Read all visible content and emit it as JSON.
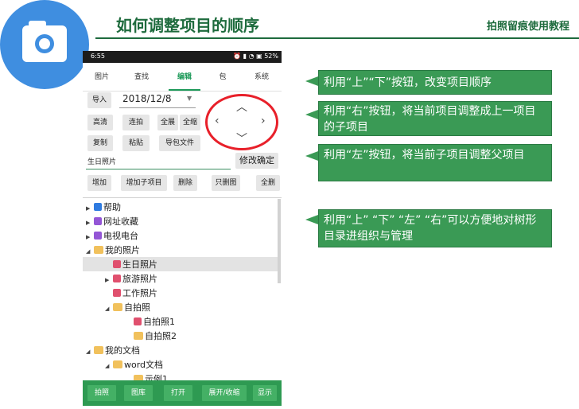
{
  "header": {
    "title": "如何调整项目的顺序",
    "subtitle": "拍照留痕使用教程",
    "logo_icon": "camera-icon"
  },
  "phone": {
    "status_bar": {
      "time": "6:55",
      "battery": "52%"
    },
    "tabs": [
      {
        "label": "图片"
      },
      {
        "label": "查找"
      },
      {
        "label": "编辑"
      },
      {
        "label": "包"
      },
      {
        "label": "系统"
      }
    ],
    "active_tab": "编辑",
    "toolbar": {
      "import_label": "导入",
      "date_value": "2018/12/8",
      "hd_label": "高清",
      "burst_label": "连拍",
      "expand_all_label": "全展",
      "collapse_all_label": "全缩",
      "copy_label": "复制",
      "paste_label": "粘贴",
      "export_pkg_label": "导包文件",
      "name_value": "生日照片",
      "rename_label": "修改确定",
      "add_label": "增加",
      "add_child_label": "增加子项目",
      "delete_label": "删除",
      "only_images_label": "只删图",
      "delete_all_label": "全删"
    },
    "arrows": {
      "up": "up-arrow-icon",
      "down": "down-arrow-icon",
      "left": "left-arrow-icon",
      "right": "right-arrow-icon"
    },
    "tree": [
      {
        "label": "帮助",
        "icon": "help-icon"
      },
      {
        "label": "网址收藏",
        "icon": "link-icon"
      },
      {
        "label": "电视电台",
        "icon": "link-icon"
      },
      {
        "label": "我的照片",
        "icon": "folder-icon"
      },
      {
        "label": "生日照片",
        "icon": "photo-icon",
        "selected": true
      },
      {
        "label": "旅游照片",
        "icon": "photo-icon"
      },
      {
        "label": "工作照片",
        "icon": "photo-icon"
      },
      {
        "label": "自拍照",
        "icon": "folder-icon"
      },
      {
        "label": "自拍照1",
        "icon": "photo-icon"
      },
      {
        "label": "自拍照2",
        "icon": "folder-icon"
      },
      {
        "label": "我的文档",
        "icon": "folder-icon"
      },
      {
        "label": "word文档",
        "icon": "folder-icon"
      },
      {
        "label": "示例1",
        "icon": "folder-icon"
      }
    ],
    "bottom_bar": [
      {
        "label": "拍照"
      },
      {
        "label": "图库"
      },
      {
        "label": "打开"
      },
      {
        "label": "展开/收缩"
      },
      {
        "label": "显示"
      }
    ]
  },
  "callouts": [
    {
      "text": "利用“上”“下”按钮，改变项目顺序"
    },
    {
      "text": "利用“右”按钮，将当前项目调整成上一项目的子项目"
    },
    {
      "text": "利用“左”按钮，将当前子项目调整父项目"
    },
    {
      "text": "利用“上” “下” “左” “右”可以方便地对树形目录进组织与管理"
    }
  ],
  "colors": {
    "brand_green": "#1e6b3d",
    "callout_green": "#3a9a55",
    "logo_blue": "#3f8ee0",
    "highlight_red": "#e8202a"
  }
}
